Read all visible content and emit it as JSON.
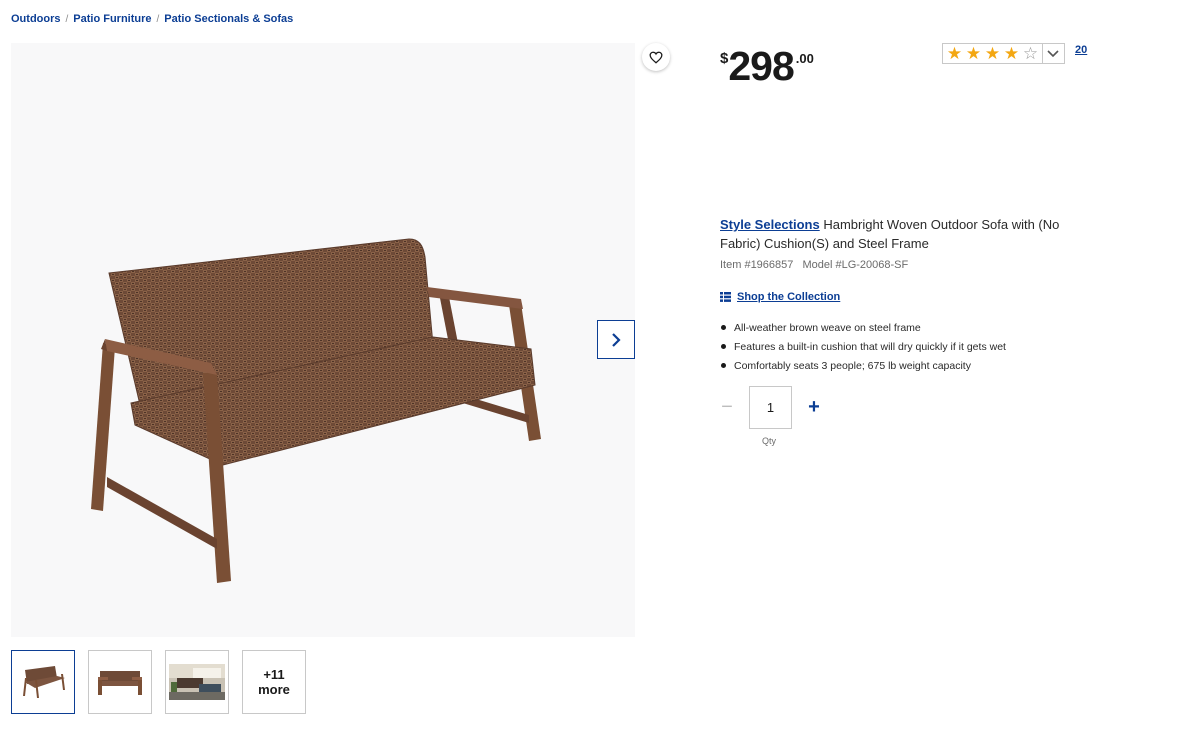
{
  "breadcrumb": [
    "Outdoors",
    "Patio Furniture",
    "Patio Sectionals & Sofas"
  ],
  "breadcrumb_sep": "/",
  "gallery": {
    "thumb_more_count": "+11",
    "thumb_more_label": "more"
  },
  "price": {
    "currency": "$",
    "whole": "298",
    "cents": ".00"
  },
  "rating": {
    "value": 4,
    "max": 5,
    "count": "20"
  },
  "product": {
    "brand": "Style Selections",
    "name": "Hambright Woven Outdoor Sofa with (No Fabric) Cushion(S) and Steel Frame",
    "item_number": "Item #1966857",
    "model_number": "Model #LG-20068-SF"
  },
  "collection_link": "Shop the Collection",
  "features": [
    "All-weather brown weave on steel frame",
    "Features a built-in cushion that will dry quickly if it gets wet",
    "Comfortably seats 3 people; 675 lb weight capacity"
  ],
  "quantity": {
    "value": "1",
    "label": "Qty",
    "minus": "−",
    "plus": "+"
  },
  "colors": {
    "accent": "#0c3e94",
    "star": "#f3a712",
    "wood": "#7a4f35",
    "wicker": "#6e4a37"
  }
}
